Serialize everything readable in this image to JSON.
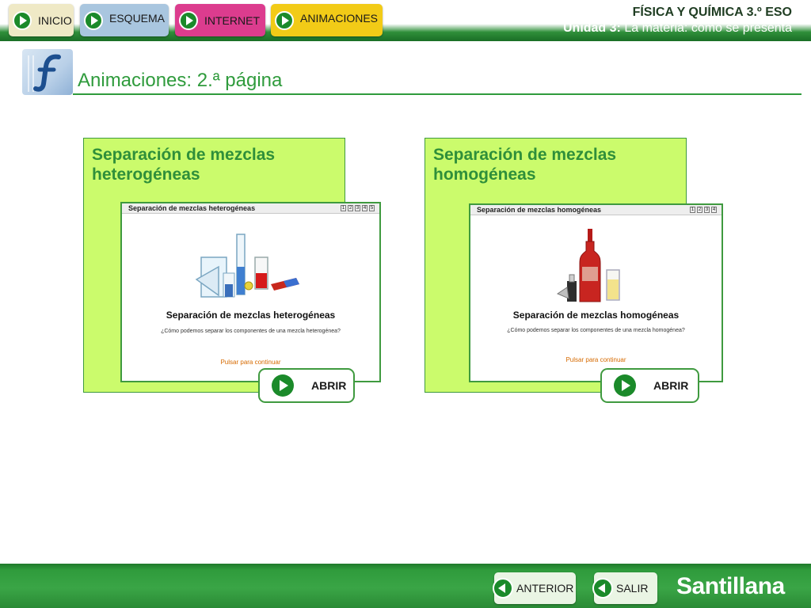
{
  "nav": {
    "inicio": "INICIO",
    "esquema": "ESQUEMA",
    "internet": "INTERNET",
    "animaciones": "ANIMACIONES"
  },
  "header": {
    "course": "FÍSICA Y QUÍMICA 3.º ESO",
    "unit_label": "Unidad 3:",
    "unit_title": "La materia: cómo se presenta"
  },
  "page": {
    "title": "Animaciones: 2.ª página"
  },
  "panels": [
    {
      "title": "Separación de mezclas heterogéneas",
      "thumb": {
        "bar_title": "Separación de mezclas heterogéneas",
        "bar_numbers": [
          "1",
          "2",
          "3",
          "4",
          "5"
        ],
        "heading": "Separación de mezclas heterogéneas",
        "question": "¿Cómo podemos separar los componentes de una mezcla heterogénea?",
        "continue": "Pulsar para continuar"
      },
      "button": "ABRIR"
    },
    {
      "title": "Separación de mezclas homogéneas",
      "thumb": {
        "bar_title": "Separación de mezclas homogéneas",
        "bar_numbers": [
          "1",
          "2",
          "3",
          "4"
        ],
        "heading": "Separación de mezclas homogéneas",
        "question": "¿Cómo podemos separar los componentes de una mezcla homogénea?",
        "continue": "Pulsar para continuar"
      },
      "button": "ABRIR"
    }
  ],
  "footer": {
    "anterior": "ANTERIOR",
    "salir": "SALIR",
    "brand": "Santillana"
  },
  "icons": {
    "nav": "play-icon",
    "abrir": "play-icon",
    "footer": "back-arrow-icon",
    "title": "flash-logo-icon"
  },
  "colors": {
    "accent_green": "#2f9b3c",
    "panel_bg": "#cbfb6c",
    "inicio_bg": "#efe9c6",
    "esquema_bg": "#a9c6df",
    "internet_bg": "#dc3c8e",
    "animaciones_bg": "#f2cb17"
  }
}
